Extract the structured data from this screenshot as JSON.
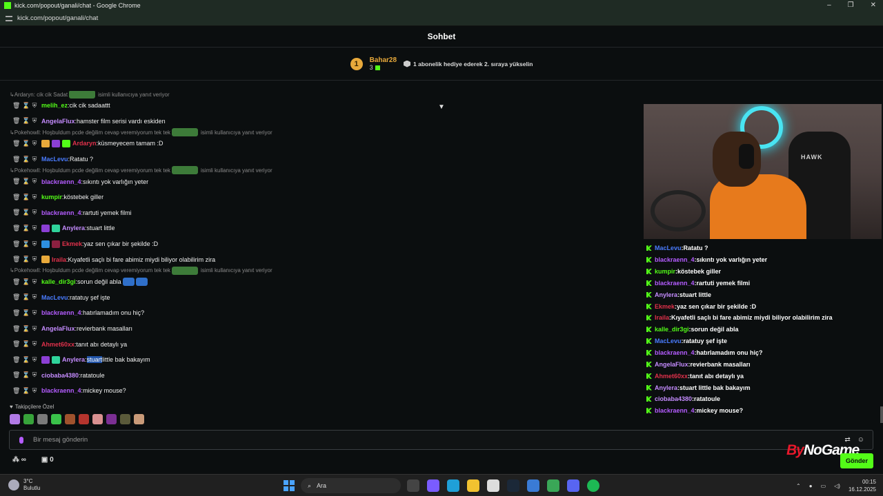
{
  "window": {
    "title": "kick.com/popout/ganali/chat - Google Chrome",
    "url": "kick.com/popout/ganali/chat"
  },
  "header": {
    "title": "Sohbet"
  },
  "sub_banner": {
    "rank": "1",
    "user": "Bahar28",
    "count": "3",
    "hint": "1 abonelik hediye ederek 2. sıraya yükselin"
  },
  "chat": {
    "rows": [
      {
        "type": "reply",
        "text": "Ardaryn: cik cik Sadat",
        "suffix": "isimli kullanıcıya yanıt veriyor"
      },
      {
        "user": "melih_ez",
        "color": "#53fc18",
        "text": "cik cik sadaattt",
        "badges": []
      },
      {
        "user": "AngelaFlux",
        "color": "#c58cff",
        "text": "hamster film serisi vardı eskiden",
        "badges": []
      },
      {
        "type": "reply",
        "text": "Pokehowll: Hoşbuldum pcde değilim cevap veremiyorum tek tek",
        "suffix": "isimli kullanıcıya yanıt veriyor"
      },
      {
        "user": "Ardaryn",
        "color": "#e0314b",
        "text": "küsmeyecem tamam :D",
        "badges": [
          "#e8a93b",
          "#8b3fd4",
          "#53fc18"
        ]
      },
      {
        "user": "MacLevu",
        "color": "#4a7cff",
        "text": "Ratatu ?",
        "badges": []
      },
      {
        "type": "reply",
        "text": "Pokehowll: Hoşbuldum pcde değilim cevap veremiyorum tek tek",
        "suffix": "isimli kullanıcıya yanıt veriyor"
      },
      {
        "user": "blackraenn_4",
        "color": "#b45cff",
        "text": "sıkıntı yok varlığın yeter",
        "badges": []
      },
      {
        "user": "kumpir",
        "color": "#53fc18",
        "text": "köstebek giller",
        "badges": []
      },
      {
        "user": "blackraenn_4",
        "color": "#b45cff",
        "text": "rartuti yemek filmi",
        "badges": []
      },
      {
        "user": "Anylera",
        "color": "#c58cff",
        "text": "stuart little",
        "badges": [
          "#8b3fd4",
          "#2fd49b"
        ]
      },
      {
        "user": "Ekmek",
        "color": "#e0314b",
        "text": "yaz sen çıkar bir şekilde :D",
        "badges": [
          "#2d8fe0",
          "#8b2040"
        ]
      },
      {
        "user": "Iraila",
        "color": "#e0314b",
        "text": "Kıyafetli saçlı bi fare abimiz miydi biliyor olabilirim zira",
        "badges": [
          "#e8a93b"
        ]
      },
      {
        "type": "reply",
        "text": "Pokehowll: Hoşbuldum pcde değilim cevap veremiyorum tek tek",
        "suffix": "isimli kullanıcıya yanıt veriyor"
      },
      {
        "user": "kalle_dir3gi",
        "color": "#53fc18",
        "text": "sorun değil abla",
        "badges": [],
        "emotes": 2
      },
      {
        "user": "MacLevu",
        "color": "#4a7cff",
        "text": "ratatuy şef işte",
        "badges": []
      },
      {
        "user": "blackraenn_4",
        "color": "#b45cff",
        "text": "hatırlamadım onu hiç?",
        "badges": []
      },
      {
        "user": "AngelaFlux",
        "color": "#c58cff",
        "text": "revierbank masalları",
        "badges": []
      },
      {
        "user": "Ahmet60xx",
        "color": "#e0314b",
        "text": "tanıt abı detaylı ya",
        "badges": []
      },
      {
        "user": "Anylera",
        "color": "#c58cff",
        "text_hl": "stuart",
        "text": " little bak bakayım",
        "badges": [
          "#8b3fd4",
          "#2fd49b"
        ]
      },
      {
        "user": "ciobaba4380",
        "color": "#c58cff",
        "text": "ratatoule",
        "badges": []
      },
      {
        "user": "blackraenn_4",
        "color": "#b45cff",
        "text": "mickey mouse?",
        "badges": []
      }
    ]
  },
  "overlay": {
    "rows": [
      {
        "user": "MacLevu",
        "color": "#4a7cff",
        "text": "Ratatu ?"
      },
      {
        "user": "blackraenn_4",
        "color": "#b45cff",
        "text": "sıkıntı yok varlığın yeter"
      },
      {
        "user": "kumpir",
        "color": "#53fc18",
        "text": "köstebek giller"
      },
      {
        "user": "blackraenn_4",
        "color": "#b45cff",
        "text": "rartuti yemek filmi"
      },
      {
        "user": "Anylera",
        "color": "#c58cff",
        "text": "stuart little"
      },
      {
        "user": "Ekmek",
        "color": "#e0314b",
        "text": "yaz sen çıkar bir şekilde :D"
      },
      {
        "user": "Iraila",
        "color": "#e0314b",
        "text": "Kıyafetli saçlı bi fare abimiz miydi biliyor olabilirim zira"
      },
      {
        "user": "kalle_dir3gi",
        "color": "#53fc18",
        "text": "sorun değil abla"
      },
      {
        "user": "MacLevu",
        "color": "#4a7cff",
        "text": "ratatuy şef işte"
      },
      {
        "user": "blackraenn_4",
        "color": "#b45cff",
        "text": "hatırlamadım onu hiç?"
      },
      {
        "user": "AngelaFlux",
        "color": "#c58cff",
        "text": "revierbank masalları"
      },
      {
        "user": "Ahmet60xx",
        "color": "#e0314b",
        "text": "tanıt abı detaylı ya"
      },
      {
        "user": "Anylera",
        "color": "#c58cff",
        "text": "stuart little bak bakayım"
      },
      {
        "user": "ciobaba4380",
        "color": "#c58cff",
        "text": "ratatoule"
      },
      {
        "user": "blackraenn_4",
        "color": "#b45cff",
        "text": "mickey mouse?"
      }
    ]
  },
  "followers_label": "Takipçilere Özel",
  "input": {
    "placeholder": "Bir mesaj gönderin",
    "send_label": "Gönder"
  },
  "bottom": {
    "infinity": "∞",
    "count": "0"
  },
  "video": {
    "brand": "HAWK"
  },
  "watermark": {
    "part1": "By",
    "part2": "NoGame"
  },
  "taskbar": {
    "temp": "3°C",
    "weather": "Bulutlu",
    "search": "Ara",
    "time": "00:15",
    "date": "16.12.2025"
  }
}
